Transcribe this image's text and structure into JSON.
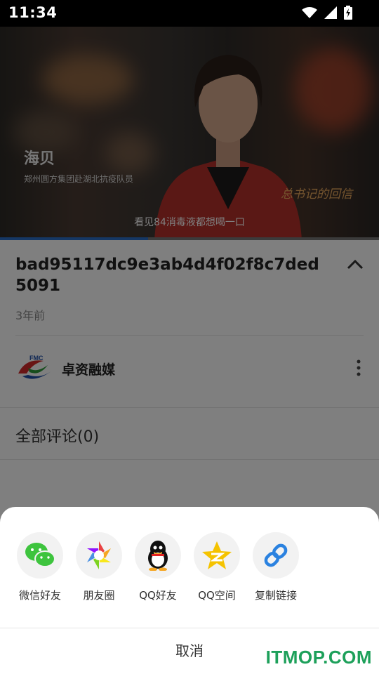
{
  "status_bar": {
    "time": "11:34"
  },
  "video": {
    "caption_name": "海贝",
    "caption_role": "郑州圆方集团赴湖北抗疫队员",
    "caption_logo": "总书记的回信",
    "subtitle": "看见84消毒液都想喝一口",
    "progress": 0.39
  },
  "detail": {
    "title": "bad95117dc9e3ab4d4f02f8c7ded5091",
    "time_ago": "3年前",
    "channel_name": "卓资融媒",
    "channel_logo_text": "FMC",
    "comments_label": "全部评论(0)"
  },
  "share_sheet": {
    "items": [
      {
        "label": "微信好友",
        "icon": "wechat-icon"
      },
      {
        "label": "朋友圈",
        "icon": "moments-icon"
      },
      {
        "label": "QQ好友",
        "icon": "qq-icon"
      },
      {
        "label": "QQ空间",
        "icon": "qzone-icon"
      },
      {
        "label": "复制链接",
        "icon": "link-icon"
      }
    ],
    "cancel_label": "取消"
  },
  "watermark": "ITMOP.COM",
  "colors": {
    "progress": "#2a6ec8",
    "wechat": "#3ec43e",
    "qzone": "#f5c300",
    "link": "#2b82e0",
    "watermark": "#1da05a"
  }
}
